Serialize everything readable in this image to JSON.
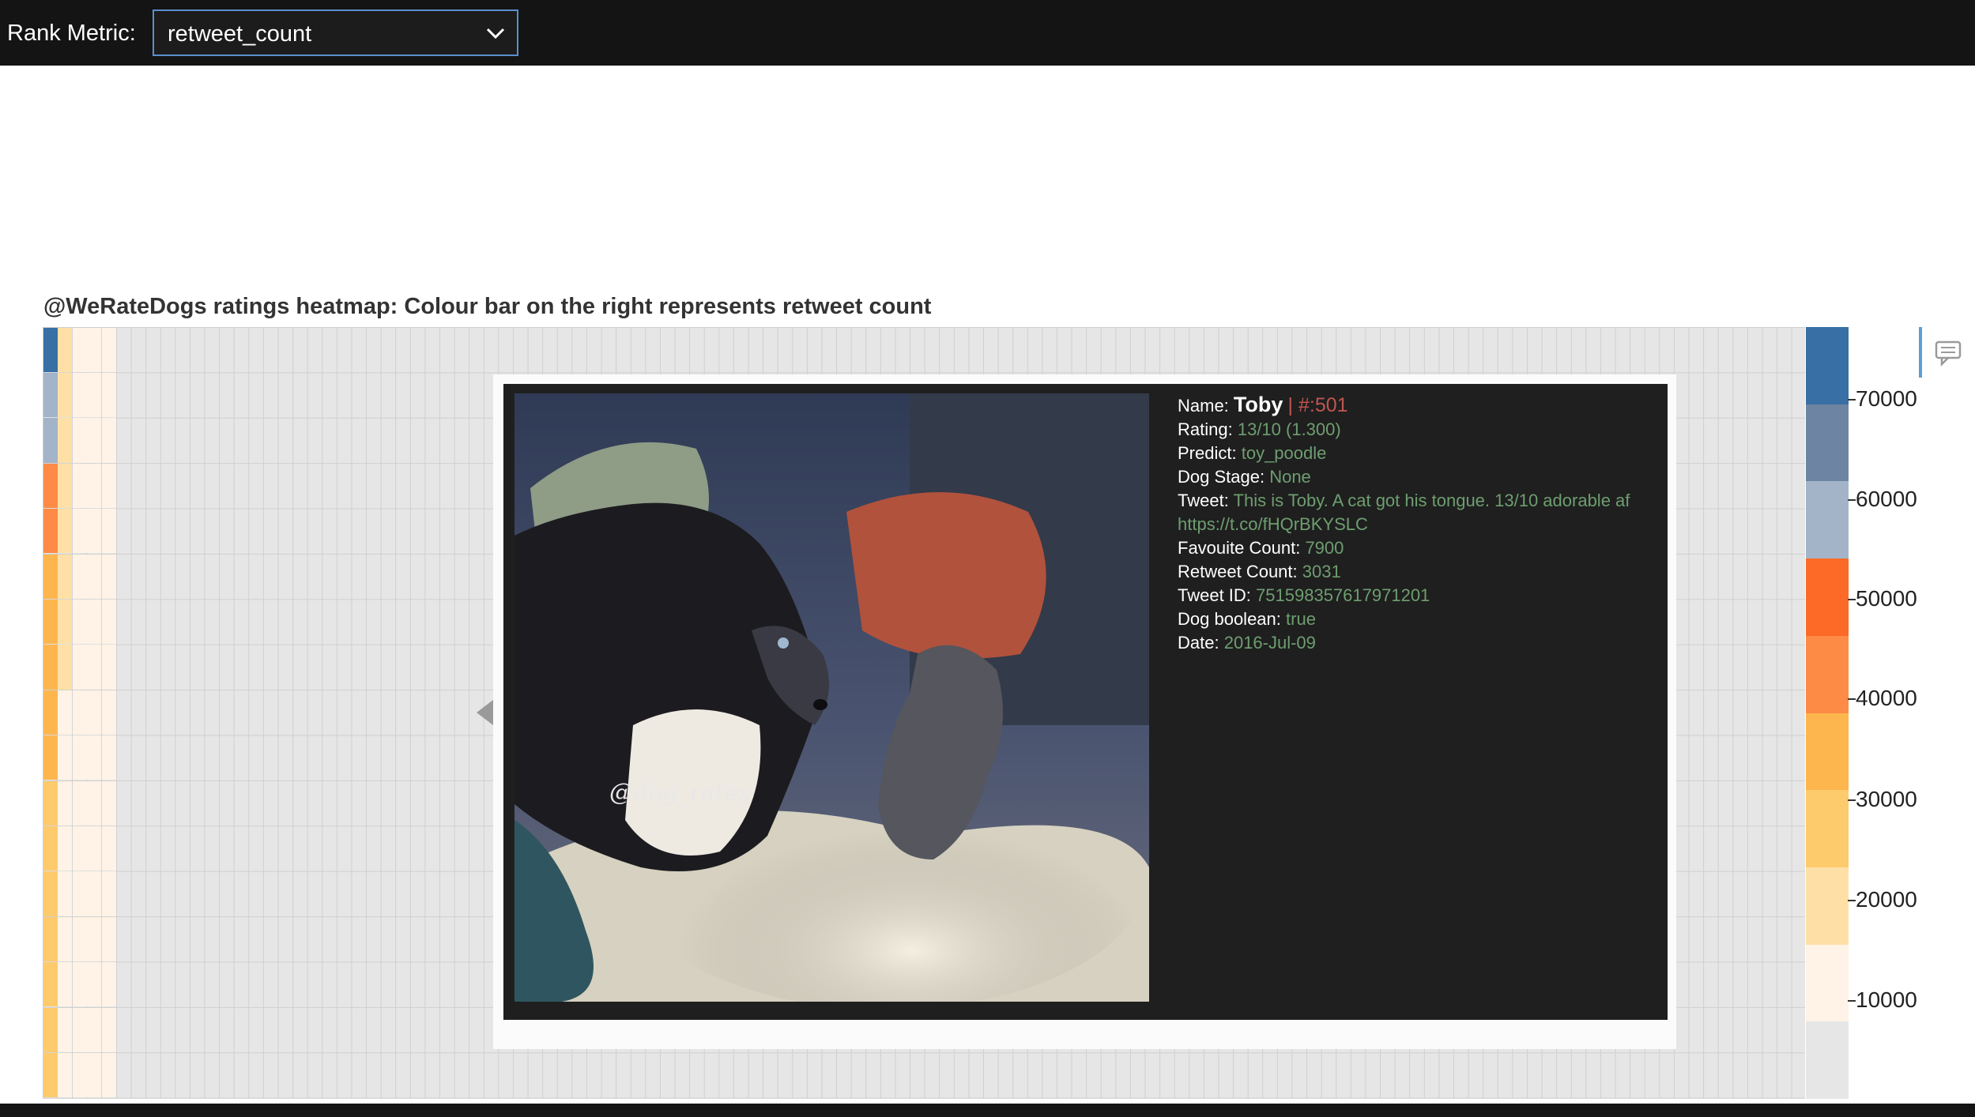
{
  "toolbar": {
    "rank_label": "Rank Metric:",
    "select_value": "retweet_count"
  },
  "chart_title": "@WeRateDogs ratings heatmap: Colour bar on the right represents retweet count",
  "chart_data": {
    "type": "heatmap",
    "title": "@WeRateDogs ratings heatmap: Colour bar on the right represents retweet count",
    "colorbar": {
      "ticks": [
        "70000",
        "60000",
        "50000",
        "40000",
        "30000",
        "20000",
        "10000"
      ],
      "colors": [
        "#386fa4",
        "#6d85a3",
        "#a3b4c8",
        "#fd6a28",
        "#fd8a45",
        "#fdb64e",
        "#fdca6c",
        "#fee0a6",
        "#fef3e6",
        "#e6e6e6"
      ]
    },
    "columns": [
      [
        "#386fa4",
        "#a3b4c8",
        "#a3b4c8",
        "#fd8a45",
        "#fd8a45",
        "#fdb64e",
        "#fdb64e",
        "#fdb64e",
        "#fdb64e",
        "#fdb64e",
        "#fdca6c",
        "#fdca6c",
        "#fdca6c",
        "#fdca6c",
        "#fdca6c",
        "#fdca6c",
        "#fdca6c",
        "#fdca6c",
        "#fee0a6",
        "#fee0a6"
      ],
      [
        "#fee0a6",
        "#fee0a6",
        "#fee0a6",
        "#fee0a6",
        "#fee0a6",
        "#fee0a6",
        "#fee0a6",
        "#fee0a6",
        "#fef3e6",
        "#fef3e6",
        "#fef3e6",
        "#fef3e6",
        "#fef3e6",
        "#fef3e6",
        "#fef3e6",
        "#fef3e6",
        "#fef3e6",
        "#fef3e6",
        "#fef3e6",
        "#fef3e6"
      ],
      [
        "#fef3e6",
        "#fef3e6",
        "#fef3e6",
        "#fef3e6",
        "#fef3e6",
        "#fef3e6",
        "#fef3e6",
        "#fef3e6",
        "#fef3e6",
        "#fef3e6",
        "#fef3e6",
        "#fef3e6",
        "#fef3e6",
        "#fef3e6",
        "#fef3e6",
        "#fef3e6",
        "#fef3e6",
        "#fef3e6",
        "#fef3e6",
        "#fef3e6"
      ],
      [
        "#fef3e6",
        "#fef3e6",
        "#fef3e6",
        "#fef3e6",
        "#fef3e6",
        "#fef3e6",
        "#fef3e6",
        "#fef3e6",
        "#fef3e6",
        "#fef3e6",
        "#fef3e6",
        "#fef3e6",
        "#fef3e6",
        "#fef3e6",
        "#fef3e6",
        "#fef3e6",
        "#fef3e6",
        "#fef3e6",
        "#fef3e6",
        "#fef3e6"
      ],
      [
        "#fef3e6",
        "#fef3e6",
        "#fef3e6",
        "#fef3e6",
        "#fef3e6",
        "#fef3e6",
        "#fef3e6",
        "#fef3e6",
        "#fef3e6",
        "#fef3e6",
        "#fef3e6",
        "#fef3e6",
        "#fef3e6",
        "#fef3e6",
        "#fef3e6",
        "#fef3e6",
        "#fef3e6",
        "#fef3e6",
        "#fef3e6",
        "#fef3e6"
      ]
    ]
  },
  "tooltip": {
    "name_label": "Name:",
    "name": "Toby",
    "rank": "| #:501",
    "rating_label": "Rating:",
    "rating": "13/10 (1.300)",
    "predict_label": "Predict:",
    "predict": "toy_poodle",
    "stage_label": "Dog Stage:",
    "stage": "None",
    "tweet_label": "Tweet:",
    "tweet": "This is Toby. A cat got his tongue. 13/10 adorable af https://t.co/fHQrBKYSLC",
    "fav_label": "Favouite Count:",
    "fav": "7900",
    "retweet_label": "Retweet Count:",
    "retweet": "3031",
    "id_label": "Tweet ID:",
    "id": "751598357617971201",
    "bool_label": "Dog boolean:",
    "bool": "true",
    "date_label": "Date:",
    "date": "2016-Jul-09",
    "watermark": "@dog_rates"
  }
}
